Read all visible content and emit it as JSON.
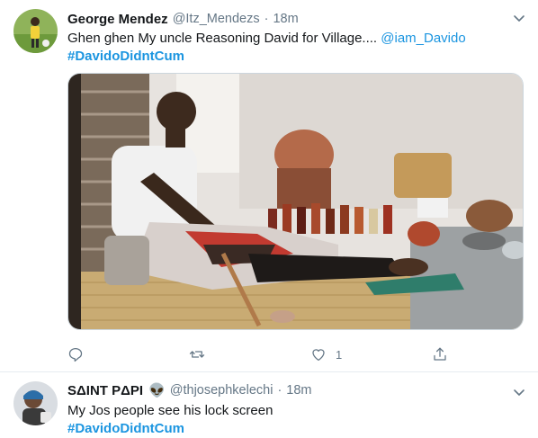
{
  "tweets": [
    {
      "author_name": "George Mendez",
      "author_handle": "@Itz_Mendezs",
      "separator": "·",
      "time": "18m",
      "text": "Ghen ghen My uncle Reasoning David for Village....",
      "mention": "@iam_Davido",
      "hashtag": "#DavidoDidntCum",
      "actions": {
        "reply_count": "",
        "retweet_count": "",
        "like_count": "1",
        "share_count": ""
      }
    },
    {
      "author_name": "SΔINT PΔPI",
      "author_emoji": "👽",
      "author_handle": "@thjosephkelechi",
      "separator": "·",
      "time": "18m",
      "text": "My Jos people see his lock screen",
      "hashtag": "#DavidoDidntCum"
    }
  ],
  "colors": {
    "link": "#1b95e0",
    "secondary_text": "#657786",
    "primary_text": "#14171a",
    "divider": "#e6ecf0"
  },
  "icons": [
    "avatar",
    "chevron-down-icon",
    "reply-icon",
    "retweet-icon",
    "like-icon",
    "share-icon",
    "alien-emoji-icon"
  ]
}
